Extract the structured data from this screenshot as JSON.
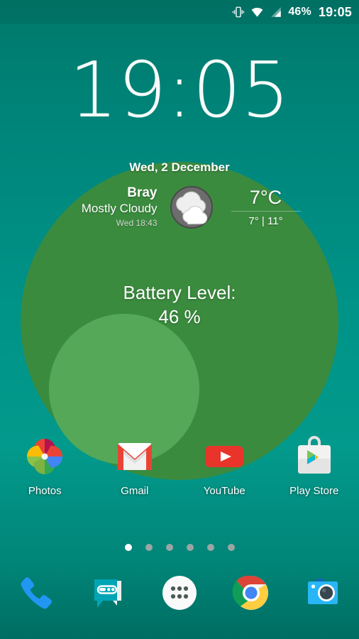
{
  "status_bar": {
    "vibrate_icon": "vibrate-icon",
    "wifi_icon": "wifi-icon",
    "signal_icon": "cell-signal-icon",
    "battery_percent": "46%",
    "clock": "19:05"
  },
  "clock_widget": {
    "time": "19:05"
  },
  "weather_widget": {
    "date": "Wed, 2 December",
    "city": "Bray",
    "condition": "Mostly Cloudy",
    "updated": "Wed 18:43",
    "icon": "cloudy-icon",
    "temperature": "7°C",
    "range": "7° | 11°"
  },
  "battery_widget": {
    "label": "Battery Level:",
    "value": "46 %"
  },
  "apps": [
    {
      "label": "Photos",
      "icon": "google-photos-icon"
    },
    {
      "label": "Gmail",
      "icon": "gmail-icon"
    },
    {
      "label": "YouTube",
      "icon": "youtube-icon"
    },
    {
      "label": "Play Store",
      "icon": "play-store-icon"
    }
  ],
  "page_indicator": {
    "total": 6,
    "active_index": 0
  },
  "dock": [
    {
      "label": "Phone",
      "icon": "phone-icon"
    },
    {
      "label": "Messenger",
      "icon": "messages-icon"
    },
    {
      "label": "All Apps",
      "icon": "app-drawer-icon"
    },
    {
      "label": "Chrome",
      "icon": "chrome-icon"
    },
    {
      "label": "Camera",
      "icon": "camera-icon"
    }
  ],
  "colors": {
    "wallpaper_teal": "#009388",
    "wallpaper_circle_dark_green": "#3b8b3f",
    "wallpaper_circle_light_green": "#54a857",
    "accent_white": "#ffffff"
  }
}
